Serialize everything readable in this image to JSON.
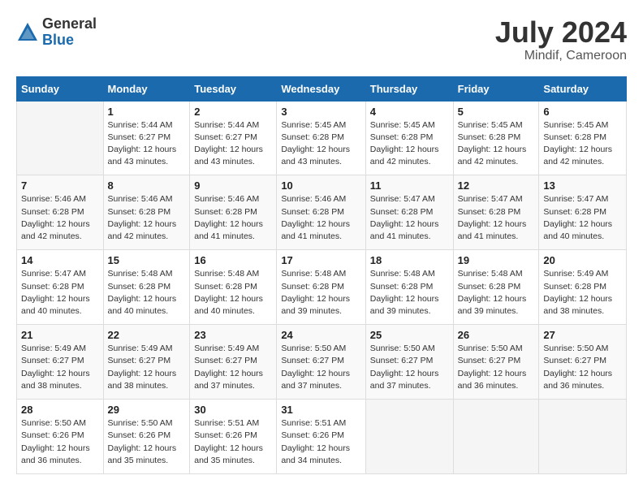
{
  "header": {
    "logo_general": "General",
    "logo_blue": "Blue",
    "month_title": "July 2024",
    "location": "Mindif, Cameroon"
  },
  "calendar": {
    "days_of_week": [
      "Sunday",
      "Monday",
      "Tuesday",
      "Wednesday",
      "Thursday",
      "Friday",
      "Saturday"
    ],
    "weeks": [
      [
        {
          "day": "",
          "info": ""
        },
        {
          "day": "1",
          "info": "Sunrise: 5:44 AM\nSunset: 6:27 PM\nDaylight: 12 hours\nand 43 minutes."
        },
        {
          "day": "2",
          "info": "Sunrise: 5:44 AM\nSunset: 6:27 PM\nDaylight: 12 hours\nand 43 minutes."
        },
        {
          "day": "3",
          "info": "Sunrise: 5:45 AM\nSunset: 6:28 PM\nDaylight: 12 hours\nand 43 minutes."
        },
        {
          "day": "4",
          "info": "Sunrise: 5:45 AM\nSunset: 6:28 PM\nDaylight: 12 hours\nand 42 minutes."
        },
        {
          "day": "5",
          "info": "Sunrise: 5:45 AM\nSunset: 6:28 PM\nDaylight: 12 hours\nand 42 minutes."
        },
        {
          "day": "6",
          "info": "Sunrise: 5:45 AM\nSunset: 6:28 PM\nDaylight: 12 hours\nand 42 minutes."
        }
      ],
      [
        {
          "day": "7",
          "info": "Sunrise: 5:46 AM\nSunset: 6:28 PM\nDaylight: 12 hours\nand 42 minutes."
        },
        {
          "day": "8",
          "info": "Sunrise: 5:46 AM\nSunset: 6:28 PM\nDaylight: 12 hours\nand 42 minutes."
        },
        {
          "day": "9",
          "info": "Sunrise: 5:46 AM\nSunset: 6:28 PM\nDaylight: 12 hours\nand 41 minutes."
        },
        {
          "day": "10",
          "info": "Sunrise: 5:46 AM\nSunset: 6:28 PM\nDaylight: 12 hours\nand 41 minutes."
        },
        {
          "day": "11",
          "info": "Sunrise: 5:47 AM\nSunset: 6:28 PM\nDaylight: 12 hours\nand 41 minutes."
        },
        {
          "day": "12",
          "info": "Sunrise: 5:47 AM\nSunset: 6:28 PM\nDaylight: 12 hours\nand 41 minutes."
        },
        {
          "day": "13",
          "info": "Sunrise: 5:47 AM\nSunset: 6:28 PM\nDaylight: 12 hours\nand 40 minutes."
        }
      ],
      [
        {
          "day": "14",
          "info": "Sunrise: 5:47 AM\nSunset: 6:28 PM\nDaylight: 12 hours\nand 40 minutes."
        },
        {
          "day": "15",
          "info": "Sunrise: 5:48 AM\nSunset: 6:28 PM\nDaylight: 12 hours\nand 40 minutes."
        },
        {
          "day": "16",
          "info": "Sunrise: 5:48 AM\nSunset: 6:28 PM\nDaylight: 12 hours\nand 40 minutes."
        },
        {
          "day": "17",
          "info": "Sunrise: 5:48 AM\nSunset: 6:28 PM\nDaylight: 12 hours\nand 39 minutes."
        },
        {
          "day": "18",
          "info": "Sunrise: 5:48 AM\nSunset: 6:28 PM\nDaylight: 12 hours\nand 39 minutes."
        },
        {
          "day": "19",
          "info": "Sunrise: 5:48 AM\nSunset: 6:28 PM\nDaylight: 12 hours\nand 39 minutes."
        },
        {
          "day": "20",
          "info": "Sunrise: 5:49 AM\nSunset: 6:28 PM\nDaylight: 12 hours\nand 38 minutes."
        }
      ],
      [
        {
          "day": "21",
          "info": "Sunrise: 5:49 AM\nSunset: 6:27 PM\nDaylight: 12 hours\nand 38 minutes."
        },
        {
          "day": "22",
          "info": "Sunrise: 5:49 AM\nSunset: 6:27 PM\nDaylight: 12 hours\nand 38 minutes."
        },
        {
          "day": "23",
          "info": "Sunrise: 5:49 AM\nSunset: 6:27 PM\nDaylight: 12 hours\nand 37 minutes."
        },
        {
          "day": "24",
          "info": "Sunrise: 5:50 AM\nSunset: 6:27 PM\nDaylight: 12 hours\nand 37 minutes."
        },
        {
          "day": "25",
          "info": "Sunrise: 5:50 AM\nSunset: 6:27 PM\nDaylight: 12 hours\nand 37 minutes."
        },
        {
          "day": "26",
          "info": "Sunrise: 5:50 AM\nSunset: 6:27 PM\nDaylight: 12 hours\nand 36 minutes."
        },
        {
          "day": "27",
          "info": "Sunrise: 5:50 AM\nSunset: 6:27 PM\nDaylight: 12 hours\nand 36 minutes."
        }
      ],
      [
        {
          "day": "28",
          "info": "Sunrise: 5:50 AM\nSunset: 6:26 PM\nDaylight: 12 hours\nand 36 minutes."
        },
        {
          "day": "29",
          "info": "Sunrise: 5:50 AM\nSunset: 6:26 PM\nDaylight: 12 hours\nand 35 minutes."
        },
        {
          "day": "30",
          "info": "Sunrise: 5:51 AM\nSunset: 6:26 PM\nDaylight: 12 hours\nand 35 minutes."
        },
        {
          "day": "31",
          "info": "Sunrise: 5:51 AM\nSunset: 6:26 PM\nDaylight: 12 hours\nand 34 minutes."
        },
        {
          "day": "",
          "info": ""
        },
        {
          "day": "",
          "info": ""
        },
        {
          "day": "",
          "info": ""
        }
      ]
    ]
  }
}
